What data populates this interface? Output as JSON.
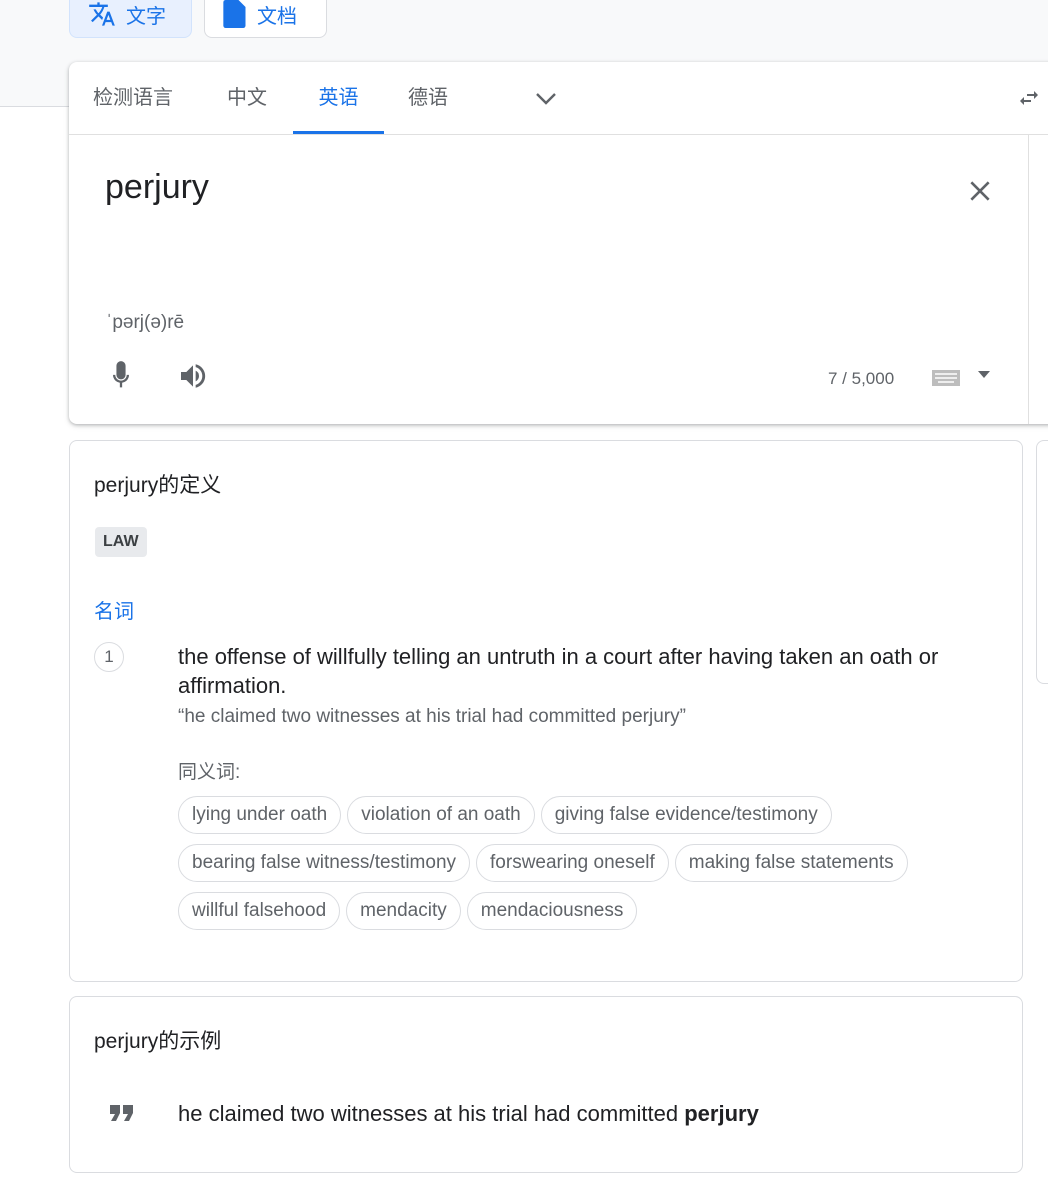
{
  "modes": [
    {
      "label": "文字",
      "icon": "translate-icon",
      "active": true
    },
    {
      "label": "文档",
      "icon": "document-icon",
      "active": false
    }
  ],
  "tabs": [
    {
      "label": "检测语言"
    },
    {
      "label": "中文"
    },
    {
      "label": "英语",
      "active": true
    },
    {
      "label": "德语"
    }
  ],
  "source": {
    "text": "perjury",
    "phonetic": "ˈpərj(ə)rē",
    "char_count": "7 / 5,000"
  },
  "definitions": {
    "title": "perjury的定义",
    "tag": "LAW",
    "pos": "名词",
    "items": [
      {
        "num": "1",
        "text": "the offense of willfully telling an untruth in a court after having taken an oath or affirmation.",
        "example": "“he claimed two witnesses at his trial had committed perjury”",
        "synonyms_label": "同义词:",
        "synonyms": [
          "lying under oath",
          "violation of an oath",
          "giving false evidence/testimony",
          "bearing false witness/testimony",
          "forswearing oneself",
          "making false statements",
          "willful falsehood",
          "mendacity",
          "mendaciousness"
        ]
      }
    ]
  },
  "examples": {
    "title": "perjury的示例",
    "items": [
      {
        "before": "he claimed two witnesses at his trial had committed ",
        "bold": "perjury"
      }
    ]
  },
  "colors": {
    "accent": "#1a73e8",
    "text": "#202124",
    "muted": "#5f6368",
    "border": "#dadce0"
  }
}
